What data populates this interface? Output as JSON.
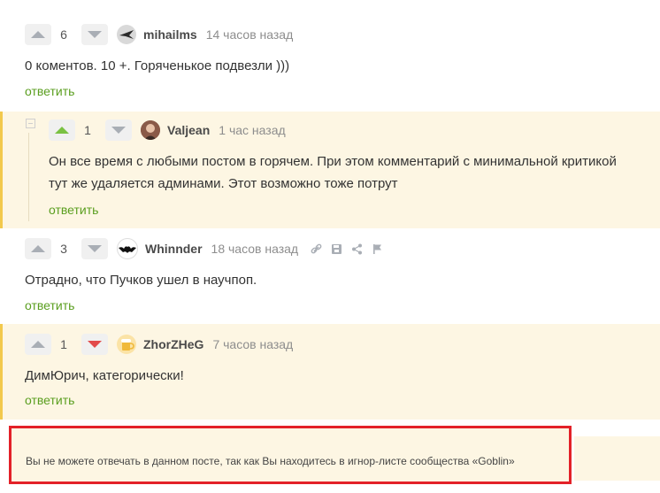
{
  "comments": [
    {
      "score": "6",
      "username": "mihailms",
      "time": "14 часов назад",
      "text": "0 коментов. 10 +. Горяченькое подвезли )))",
      "reply": "ответить"
    },
    {
      "score": "1",
      "username": "Valjean",
      "time": "1 час назад",
      "text_line1": "Он все время с любыми постом в горячем. При этом комментарий с минимальной критикой",
      "text_line2": "тут же удаляется админами. Этот возможно тоже потрут",
      "reply": "ответить"
    },
    {
      "score": "3",
      "username": "Whinnder",
      "time": "18 часов назад",
      "text": "Отрадно, что Пучков ушел в научпоп.",
      "reply": "ответить"
    },
    {
      "score": "1",
      "username": "ZhorZHeG",
      "time": "7 часов назад",
      "text": "ДимЮрич, категорически!",
      "reply": "ответить"
    }
  ],
  "notice": "Вы не можете отвечать в данном посте, так как Вы находитесь в игнор-листе сообщества «Goblin»",
  "colors": {
    "accent_green": "#7ac143",
    "link_green": "#5a9e1f",
    "downvote_red": "#e24a4a",
    "highlight_bg": "#fdf6e3",
    "notice_border": "#e32128"
  }
}
